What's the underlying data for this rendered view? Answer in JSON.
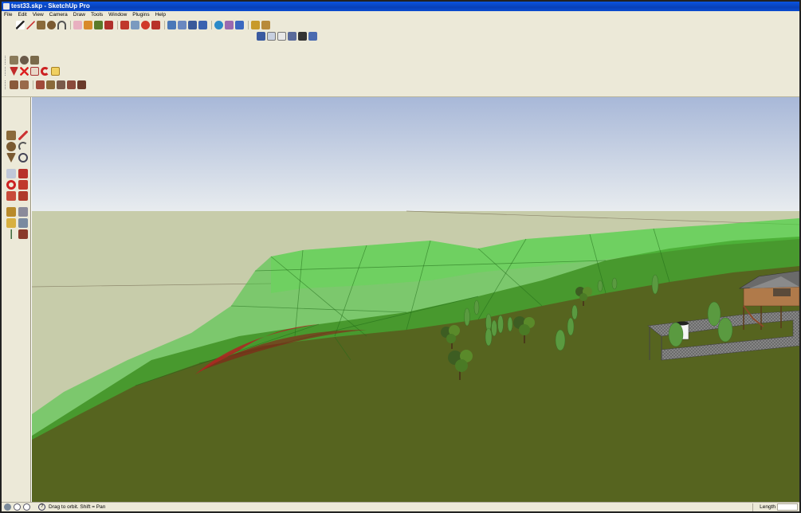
{
  "window": {
    "title": "test33.skp - SketchUp Pro"
  },
  "menu": [
    {
      "label": "File"
    },
    {
      "label": "Edit"
    },
    {
      "label": "View"
    },
    {
      "label": "Camera"
    },
    {
      "label": "Draw"
    },
    {
      "label": "Tools"
    },
    {
      "label": "Window"
    },
    {
      "label": "Plugins"
    },
    {
      "label": "Help"
    }
  ],
  "toolbars": {
    "main": [
      "select-icon",
      "line-icon",
      "rectangle-icon",
      "circle-icon",
      "arc-icon",
      "eraser-icon",
      "paint-bucket-icon",
      "tape-measure-icon",
      "move-icon",
      "push-pull-icon",
      "rotate-icon",
      "follow-me-icon",
      "orbit-icon",
      "pan-icon",
      "zoom-icon",
      "zoom-extents-icon",
      "components-icon",
      "materials-icon",
      "geo-location-icon",
      "warehouse-icon"
    ],
    "views": [
      "iso-view-icon",
      "top-view-icon",
      "front-view-icon",
      "right-view-icon",
      "back-view-icon",
      "left-view-icon"
    ],
    "styles": [
      "xray-icon",
      "wireframe-icon",
      "hidden-line-icon"
    ],
    "sections": [
      "section-plane-icon",
      "delete-icon",
      "section-display-icon",
      "redo-icon",
      "export-icon"
    ],
    "sandbox": [
      "sandbox-contours-icon",
      "sandbox-scratch-icon",
      "smoove-icon",
      "stamp-icon",
      "drape-icon",
      "add-detail-icon",
      "flip-edge-icon"
    ]
  },
  "left_toolbar": [
    "rectangle-icon",
    "pencil-icon",
    "circle-icon",
    "arc-icon",
    "paint-bucket-icon",
    "eraser-icon",
    "move-icon",
    "push-pull-icon",
    "rotate-icon",
    "follow-me-icon",
    "scale-icon",
    "offset-icon",
    "tape-measure-icon",
    "dimension-icon",
    "protractor-icon",
    "text-icon",
    "axes-icon",
    "3d-text-icon"
  ],
  "status": {
    "hint": "Drag to orbit.  Shift = Pan",
    "measurement_label": "Length",
    "measurement_value": ""
  },
  "colors": {
    "sky_top": "#a8b8d8",
    "sky_bottom": "#e8ecef",
    "horizon_ground": "#c7ccaa",
    "terrain": "#56641f",
    "terrain_overlay": "#3ec43a",
    "highlight": "#b22222",
    "toolbar_bg": "#ece9d8",
    "titlebar": "#0a54e0"
  }
}
